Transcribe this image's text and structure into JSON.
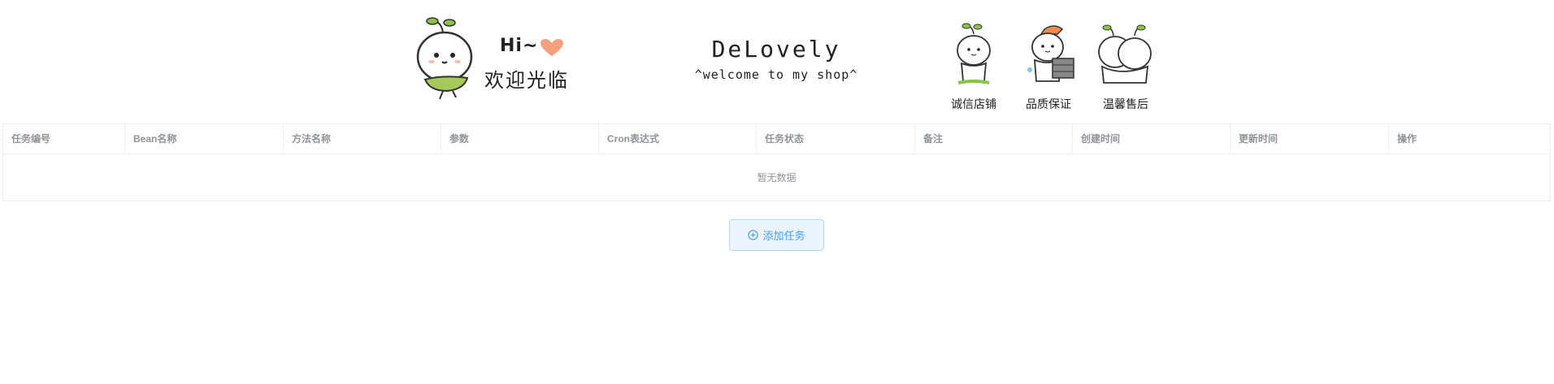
{
  "banner": {
    "hi_text": "Hi~",
    "welcome_cn": "欢迎光临",
    "shop_name": "DeLovely",
    "shop_subtitle": "^welcome to my shop^",
    "features": [
      {
        "label": "诚信店铺",
        "icon": "sprout-character-praying-icon"
      },
      {
        "label": "品质保证",
        "icon": "sprout-character-with-box-icon"
      },
      {
        "label": "温馨售后",
        "icon": "sprout-characters-hugging-icon"
      }
    ],
    "heart_color": "#f4a07c"
  },
  "table": {
    "columns": [
      "任务编号",
      "Bean名称",
      "方法名称",
      "参数",
      "Cron表达式",
      "任务状态",
      "备注",
      "创建时间",
      "更新时间",
      "操作"
    ],
    "empty_text": "暂无数据"
  },
  "actions": {
    "add_task_label": "添加任务",
    "add_task_icon": "circle-plus-icon",
    "accent_color": "#409eff"
  }
}
